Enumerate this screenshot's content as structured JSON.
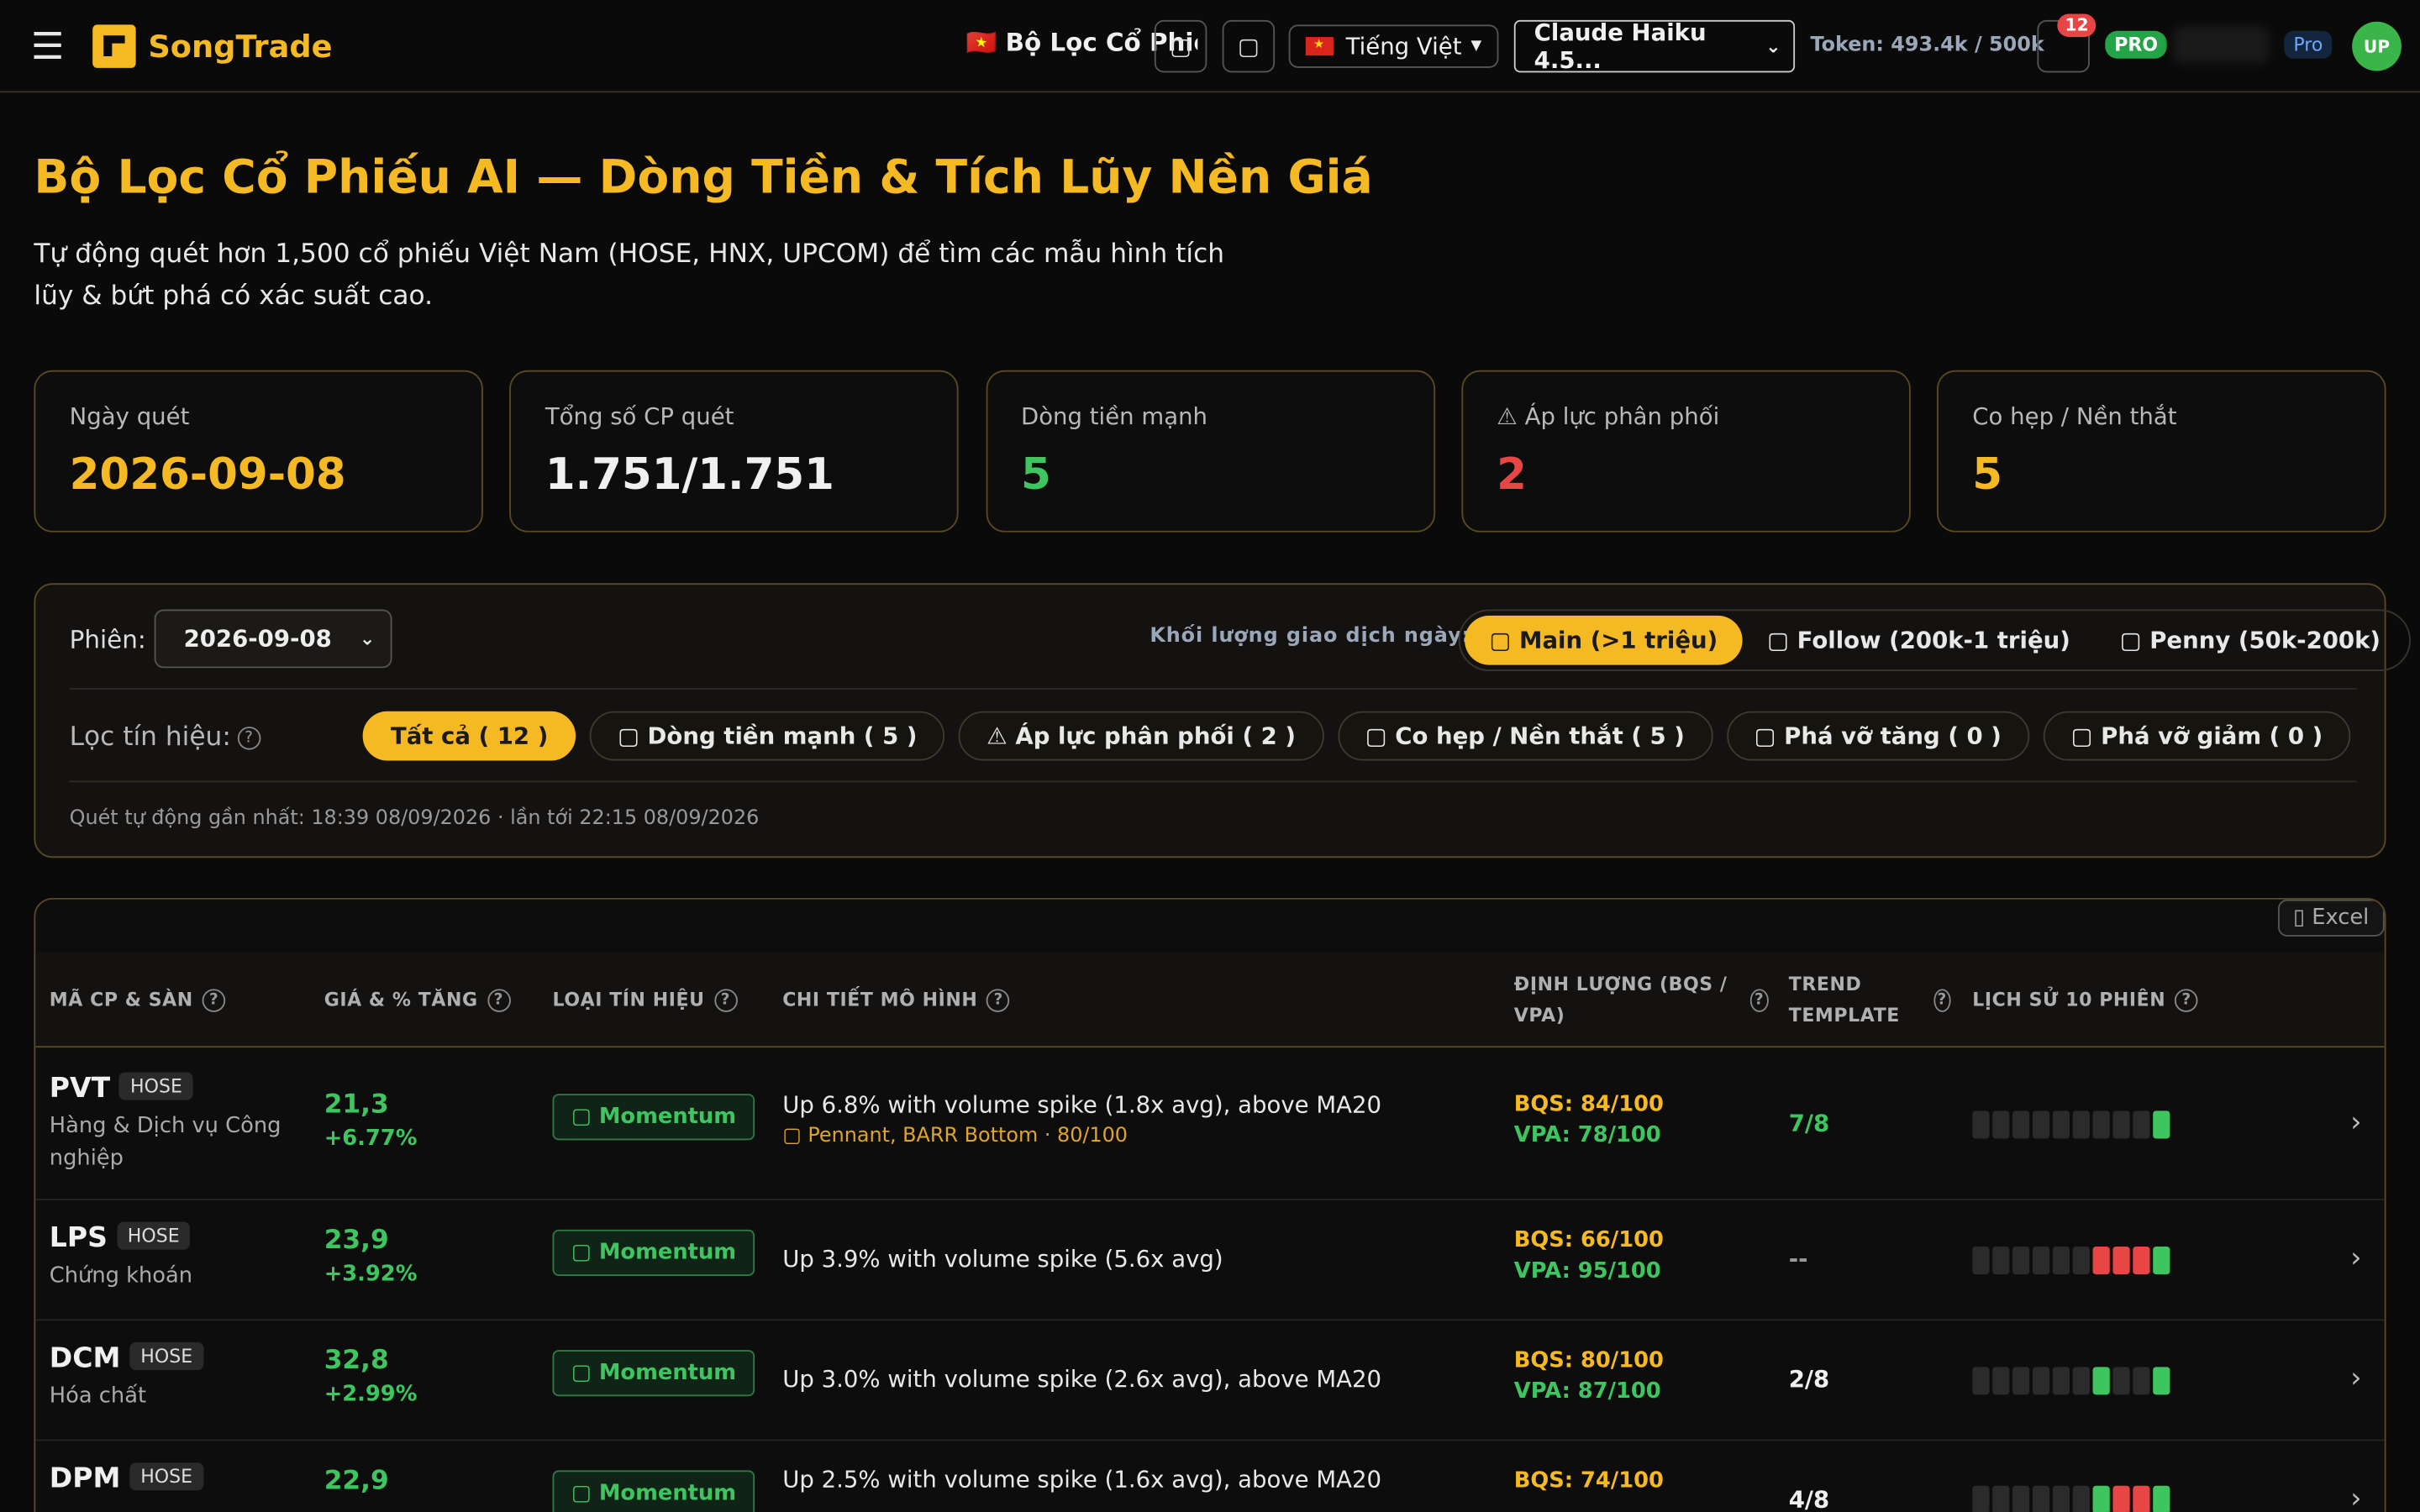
{
  "topbar": {
    "menu_icon": "hamburger-icon",
    "brand": "SongTrade",
    "page_title": "🇻🇳 Bộ Lọc Cổ Phiếu",
    "language": "Tiếng Việt",
    "model": "Claude Haiku 4.5...",
    "token": "Token: 493.4k / 500k",
    "notifications": "12",
    "pro_badge": "PRO",
    "plan": "Pro",
    "avatar": "UP"
  },
  "header": {
    "title": "Bộ Lọc Cổ Phiếu AI — Dòng Tiền & Tích Lũy Nền Giá",
    "subtitle": "Tự động quét hơn 1,500 cổ phiếu Việt Nam (HOSE, HNX, UPCOM) để tìm các mẫu hình tích lũy & bứt phá có xác suất cao."
  },
  "stats": [
    {
      "label": "Ngày quét",
      "value": "2026-09-08",
      "color": "#f5b923"
    },
    {
      "label": "Tổng số CP quét",
      "value": "1.751/1.751",
      "color": "#f0f0f0"
    },
    {
      "label": "Dòng tiền mạnh",
      "value": "5",
      "color": "#3fc560"
    },
    {
      "label": "⚠ Áp lực phân phối",
      "value": "2",
      "color": "#e84545"
    },
    {
      "label": "Co hẹp / Nền thắt",
      "value": "5",
      "color": "#f5b923"
    }
  ],
  "filters": {
    "session_label": "Phiên:",
    "session_value": "2026-09-08",
    "volume_label": "Khối lượng giao dịch ngày:",
    "volume_options": [
      "Main (>1 triệu)",
      "Follow (200k-1 triệu)",
      "Penny (50k-200k)"
    ],
    "signal_label": "Lọc tín hiệu:",
    "signals": [
      "Tất cả ( 12 )",
      "Dòng tiền mạnh ( 5 )",
      "⚠ Áp lực phân phối ( 2 )",
      "Co hẹp / Nền thắt ( 5 )",
      "Phá vỡ tăng ( 0 )",
      "Phá vỡ giảm ( 0 )"
    ],
    "scan_note": "Quét tự động gần nhất: 18:39 08/09/2026 · lần tới 22:15 08/09/2026"
  },
  "table": {
    "export": "Excel",
    "headers": [
      "MÃ CP & SÀN",
      "GIÁ & % TĂNG",
      "LOẠI TÍN HIỆU",
      "CHI TIẾT MÔ HÌNH",
      "ĐỊNH LƯỢNG (BQS / VPA)",
      "TREND TEMPLATE",
      "LỊCH SỬ 10 PHIÊN"
    ],
    "rows": [
      {
        "ticker": "PVT",
        "exchange": "HOSE",
        "sector": "Hàng & Dịch vụ Công nghiệp",
        "price": "21,3",
        "pct": "+6.77%",
        "signal": "Momentum",
        "detail": "Up 6.8% with volume spike (1.8x avg), above MA20",
        "detail_sub": "Pennant, BARR Bottom · 80/100",
        "bqs": "BQS: 84/100",
        "vpa": "VPA: 78/100",
        "trend": "7/8",
        "trend_color": "#3fc560",
        "history": [
          "n",
          "n",
          "n",
          "n",
          "n",
          "n",
          "n",
          "n",
          "n",
          "g"
        ]
      },
      {
        "ticker": "LPS",
        "exchange": "HOSE",
        "sector": "Chứng khoán",
        "price": "23,9",
        "pct": "+3.92%",
        "signal": "Momentum",
        "detail": "Up 3.9% with volume spike (5.6x avg)",
        "detail_sub": "",
        "bqs": "BQS: 66/100",
        "vpa": "VPA: 95/100",
        "trend": "--",
        "trend_color": "#999999",
        "history": [
          "n",
          "n",
          "n",
          "n",
          "n",
          "n",
          "r",
          "r",
          "r",
          "g"
        ]
      },
      {
        "ticker": "DCM",
        "exchange": "HOSE",
        "sector": "Hóa chất",
        "price": "32,8",
        "pct": "+2.99%",
        "signal": "Momentum",
        "detail": "Up 3.0% with volume spike (2.6x avg), above MA20",
        "detail_sub": "",
        "bqs": "BQS: 80/100",
        "vpa": "VPA: 87/100",
        "trend": "2/8",
        "trend_color": "#f0f0f0",
        "history": [
          "n",
          "n",
          "n",
          "n",
          "n",
          "n",
          "g",
          "n",
          "n",
          "g"
        ]
      },
      {
        "ticker": "DPM",
        "exchange": "HOSE",
        "sector": "",
        "price": "22,9",
        "pct": "",
        "signal": "Momentum",
        "detail": "Up 2.5% with volume spike (1.6x avg), above MA20",
        "detail_sub": "",
        "bqs": "BQS: 74/100",
        "vpa": "",
        "trend": "4/8",
        "trend_color": "#f0f0f0",
        "history": [
          "n",
          "n",
          "n",
          "n",
          "n",
          "n",
          "g",
          "r",
          "r",
          "g"
        ]
      }
    ]
  }
}
